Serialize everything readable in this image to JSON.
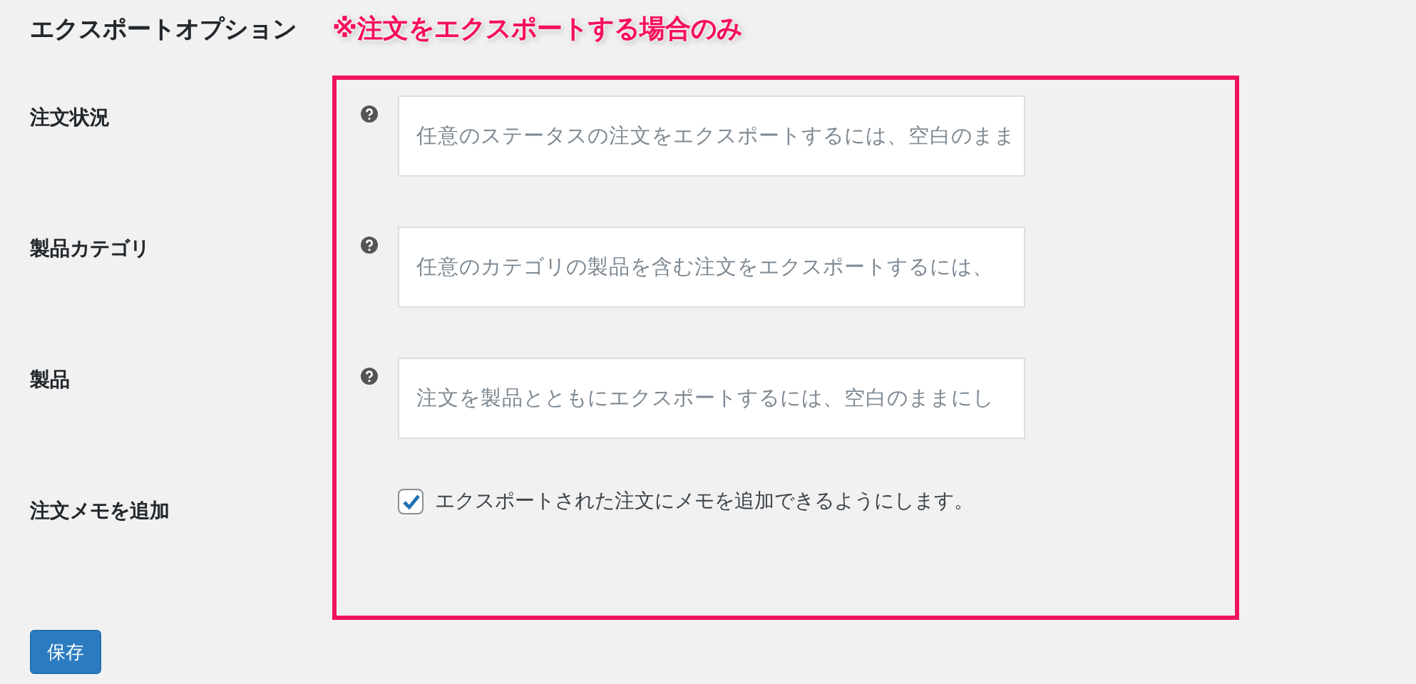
{
  "heading": "エクスポートオプション",
  "annotation": "※注文をエクスポートする場合のみ",
  "options": [
    {
      "kind": "field",
      "label": "注文状況",
      "placeholder": "任意のステータスの注文をエクスポートするには、空白のまま"
    },
    {
      "kind": "field",
      "label": "製品カテゴリ",
      "placeholder": "任意のカテゴリの製品を含む注文をエクスポートするには、"
    },
    {
      "kind": "field",
      "label": "製品",
      "placeholder": "注文を製品とともにエクスポートするには、空白のままにし"
    },
    {
      "kind": "checkbox",
      "label": "注文メモを追加",
      "text": "エクスポートされた注文にメモを追加できるようにします。",
      "checked": true
    }
  ],
  "save_button": "保存"
}
